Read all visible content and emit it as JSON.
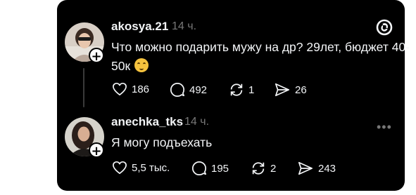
{
  "post": {
    "username": "akosya.21",
    "time": "14 ч.",
    "text": "Что можно подарить мужу на др? 29лет, бюджет 40-50к",
    "likes": "186",
    "replies": "492",
    "reposts": "1",
    "shares": "26"
  },
  "reply": {
    "username": "anechka_tks",
    "time": "14 ч.",
    "text": "Я могу подъехать",
    "likes": "5,5 тыс.",
    "replies": "195",
    "reposts": "2",
    "shares": "243"
  },
  "icons": {
    "app_logo": "threads-logo-icon",
    "more": "more-icon",
    "like": "heart-icon",
    "reply": "comment-icon",
    "repost": "repost-icon",
    "share": "share-icon",
    "emoji": "upside-down-face-emoji-icon"
  },
  "colors": {
    "card_bg": "#000000",
    "text": "#f3f5f7",
    "muted": "#777777"
  }
}
